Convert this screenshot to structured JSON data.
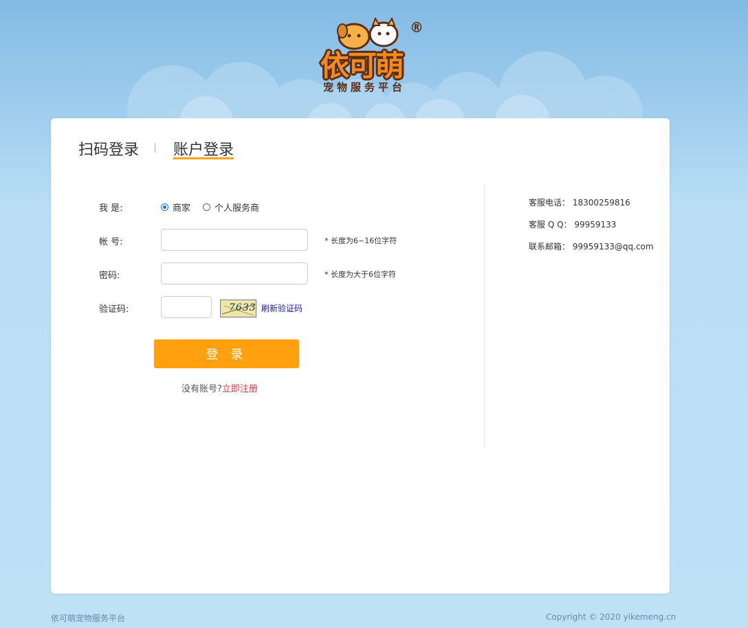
{
  "header": {
    "logo_main": "依可萌",
    "logo_sub": "宠物服务平台",
    "logo_reg": "®"
  },
  "tabs": [
    {
      "label": "扫码登录",
      "active": false
    },
    {
      "label": "账户登录",
      "active": true
    }
  ],
  "form": {
    "role_label": "我 是:",
    "roles": [
      {
        "label": "商家",
        "checked": true
      },
      {
        "label": "个人服务商",
        "checked": false
      }
    ],
    "account_label": "帐 号:",
    "account_value": "",
    "account_hint": "* 长度为6~16位字符",
    "password_label": "密码:",
    "password_value": "",
    "password_hint": "* 长度为大于6位字符",
    "captcha_label": "验证码:",
    "captcha_value": "",
    "captcha_image_text": "7633",
    "refresh_label": "刷新验证码",
    "login_label": "登 录",
    "register_prompt": "没有账号?",
    "register_link": "立即注册"
  },
  "contact": {
    "phone": "客服电话：  18300259816",
    "qq": "客服 Q Q：  99959133",
    "email": "联系邮箱：  99959133@qq.com"
  },
  "footer": {
    "left": "依可萌宠物服务平台",
    "right": "Copyright © 2020 yikemeng.cn"
  },
  "colors": {
    "accent": "#ffa10e",
    "tab_underline": "#f5a21c",
    "link_red": "#e0353e",
    "radio_blue": "#1a73e8"
  }
}
